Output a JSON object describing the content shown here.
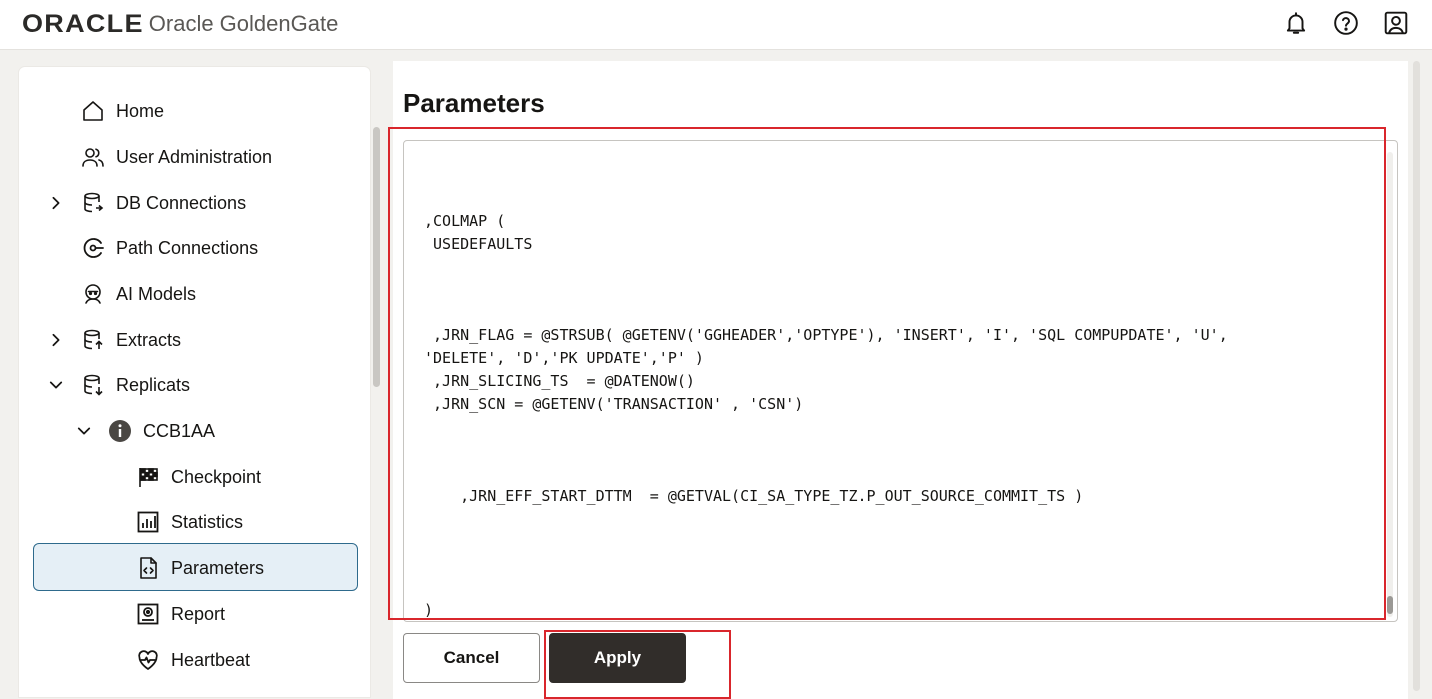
{
  "header": {
    "logo_text": "ORACLE",
    "product_name": "Oracle GoldenGate",
    "icons": [
      "notification-bell-icon",
      "help-icon",
      "user-profile-icon"
    ]
  },
  "sidebar": {
    "items": [
      {
        "label": "Home",
        "icon": "home-icon",
        "expandable": false
      },
      {
        "label": "User Administration",
        "icon": "users-icon",
        "expandable": false
      },
      {
        "label": "DB Connections",
        "icon": "database-icon",
        "expandable": true,
        "expanded": false
      },
      {
        "label": "Path Connections",
        "icon": "path-icon",
        "expandable": false
      },
      {
        "label": "AI Models",
        "icon": "ai-model-icon",
        "expandable": false
      },
      {
        "label": "Extracts",
        "icon": "extract-icon",
        "expandable": true,
        "expanded": false
      },
      {
        "label": "Replicats",
        "icon": "replicat-icon",
        "expandable": true,
        "expanded": true
      },
      {
        "label": "CCB1AA",
        "icon": "info-icon",
        "expandable": true,
        "expanded": true
      },
      {
        "label": "Checkpoint",
        "icon": "checkered-flag-icon",
        "expandable": false
      },
      {
        "label": "Statistics",
        "icon": "bar-chart-icon",
        "expandable": false
      },
      {
        "label": "Parameters",
        "icon": "code-file-icon",
        "expandable": false,
        "selected": true
      },
      {
        "label": "Report",
        "icon": "report-icon",
        "expandable": false
      },
      {
        "label": "Heartbeat",
        "icon": "heartbeat-icon",
        "expandable": false
      }
    ]
  },
  "main": {
    "title": "Parameters",
    "editor_lines": [
      "",
      "",
      "",
      ",COLMAP (",
      " USEDEFAULTS",
      "",
      "",
      "",
      " ,JRN_FLAG = @STRSUB( @GETENV('GGHEADER','OPTYPE'), 'INSERT', 'I', 'SQL COMPUPDATE', 'U',",
      "'DELETE', 'D','PK UPDATE','P' )",
      " ,JRN_SLICING_TS  = @DATENOW()",
      " ,JRN_SCN = @GETENV('TRANSACTION' , 'CSN')",
      "",
      "",
      "",
      "    ,JRN_EFF_START_DTTM  = @GETVAL(CI_SA_TYPE_TZ.P_OUT_SOURCE_COMMIT_TS )",
      "",
      "",
      "",
      "",
      ")",
      " ;"
    ],
    "cancel_label": "Cancel",
    "apply_label": "Apply"
  },
  "colors": {
    "accent_selected_bg": "#e5eff6",
    "accent_selected_border": "#2e6a8c",
    "apply_bg": "#312d2a",
    "highlight": "#d9262c"
  }
}
